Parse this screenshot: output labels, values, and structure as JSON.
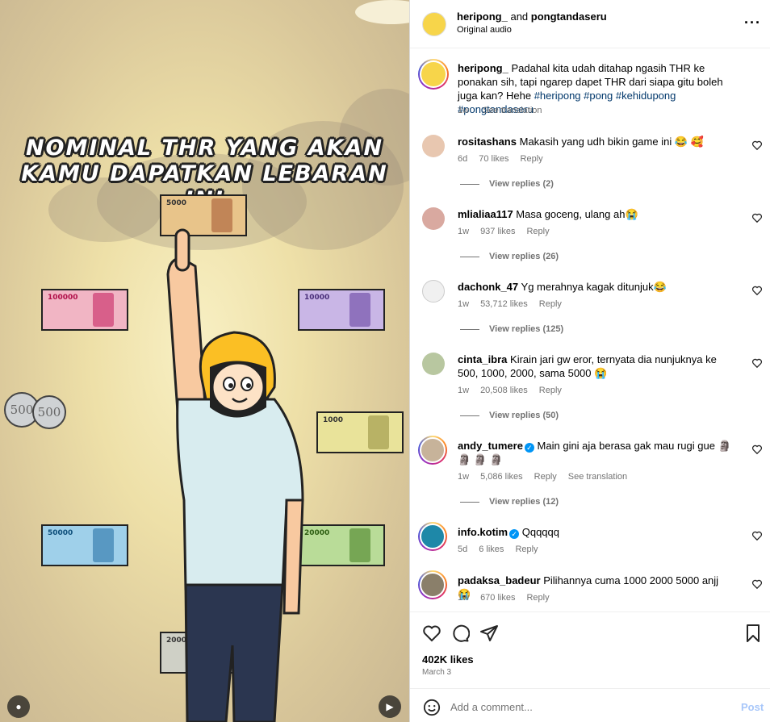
{
  "media": {
    "title_line1": "NOMINAL THR YANG AKAN",
    "title_line2": "KAMU DAPATKAN LEBARAN INI",
    "banknotes": [
      {
        "label": "5000",
        "color": "#e8c48a"
      },
      {
        "label": "100000",
        "color": "#f1b5c4"
      },
      {
        "label": "10000",
        "color": "#c9b6e6"
      },
      {
        "label": "1000",
        "color": "#e9e39a"
      },
      {
        "label": "50000",
        "color": "#9fd0ea"
      },
      {
        "label": "20000",
        "color": "#b9dc98"
      },
      {
        "label": "2000",
        "color": "#cfd0c6"
      }
    ],
    "coins": [
      "500",
      "500"
    ]
  },
  "header": {
    "user1": "heripong_",
    "and_text": "and",
    "user2": "pongtandaseru",
    "audio": "Original audio",
    "more_icon": "more-horizontal-icon"
  },
  "caption": {
    "user": "heripong_",
    "text": "Padahal kita udah ditahap ngasih THR ke ponakan sih, tapi ngarep dapet THR dari siapa gitu boleh juga kan? Hehe",
    "hashtags": "#heripong #pong #kehidupong #pongtandaseru",
    "time": "1w",
    "see_translation": "See translation"
  },
  "comments": [
    {
      "user": "rositashans",
      "verified": false,
      "text": "Makasih yang udh bikin game ini 😂 🥰",
      "time": "6d",
      "likes": "70 likes",
      "reply": "Reply",
      "view_replies": "View replies (2)"
    },
    {
      "user": "mlialiaa117",
      "verified": false,
      "text": "Masa goceng, ulang ah😭",
      "time": "1w",
      "likes": "937 likes",
      "reply": "Reply",
      "view_replies": "View replies (26)"
    },
    {
      "user": "dachonk_47",
      "verified": false,
      "text": "Yg merahnya kagak ditunjuk😂",
      "time": "1w",
      "likes": "53,712 likes",
      "reply": "Reply",
      "view_replies": "View replies (125)"
    },
    {
      "user": "cinta_ibra",
      "verified": false,
      "text": "Kirain jari gw eror, ternyata dia nunjuknya ke 500, 1000, 2000, sama 5000 😭",
      "time": "1w",
      "likes": "20,508 likes",
      "reply": "Reply",
      "view_replies": "View replies (50)"
    },
    {
      "user": "andy_tumere",
      "verified": true,
      "text": "Main gini aja berasa gak mau rugi gue 🗿 🗿 🗿 🗿",
      "time": "1w",
      "likes": "5,086 likes",
      "reply": "Reply",
      "see_translation": "See translation",
      "view_replies": "View replies (12)"
    },
    {
      "user": "info.kotim",
      "verified": true,
      "text": "Qqqqqq",
      "time": "5d",
      "likes": "6 likes",
      "reply": "Reply"
    },
    {
      "user": "padaksa_badeur",
      "verified": false,
      "text": "Pilihannya cuma 1000 2000 5000 anjj 😭",
      "time": "1w",
      "likes": "670 likes",
      "reply": "Reply"
    }
  ],
  "actions": {
    "likes": "402K likes",
    "date": "March 3"
  },
  "add_comment": {
    "placeholder": "Add a comment...",
    "post": "Post"
  },
  "colors": {
    "link_blue": "#00376b",
    "secondary": "#737373",
    "post_blue": "#a8c7fa",
    "verified": "#0095f6"
  }
}
